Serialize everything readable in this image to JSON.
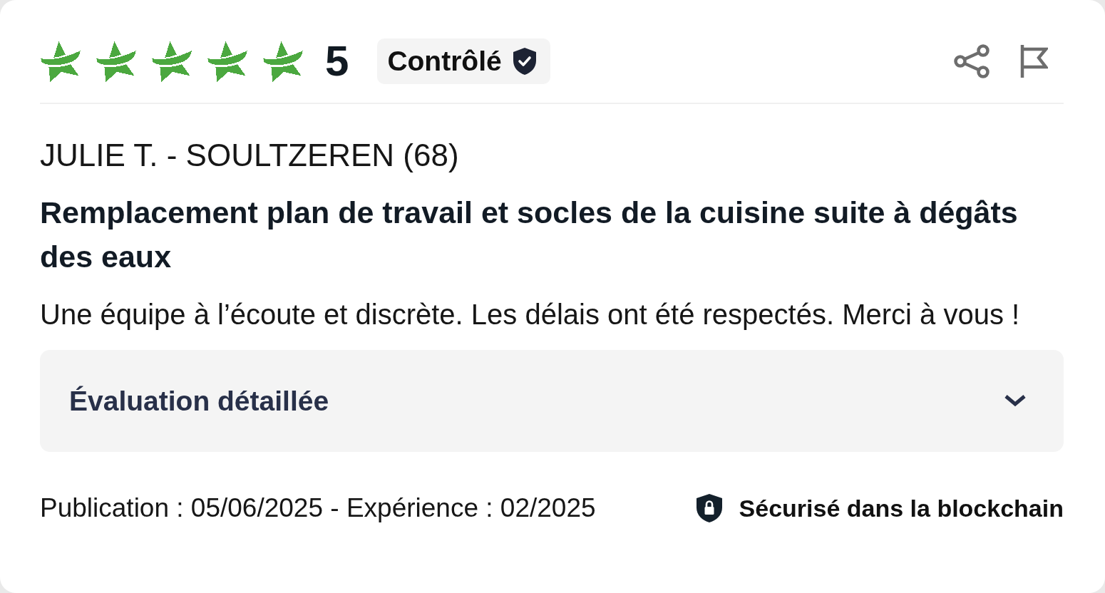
{
  "review": {
    "stars": 5,
    "score": "5",
    "badge": {
      "label": "Contrôlé"
    },
    "author": "JULIE T. - SOULTZEREN (68)",
    "title": "Remplacement plan de travail et socles de la cuisine suite à dégâts des eaux",
    "body": "Une équipe à l’écoute et discrète. Les délais ont été respectés. Merci à vous !",
    "details": {
      "label": "Évaluation détaillée",
      "expanded": false
    },
    "dates": "Publication : 05/06/2025 - Expérience : 02/2025",
    "security": "Sécurisé dans la blockchain"
  }
}
